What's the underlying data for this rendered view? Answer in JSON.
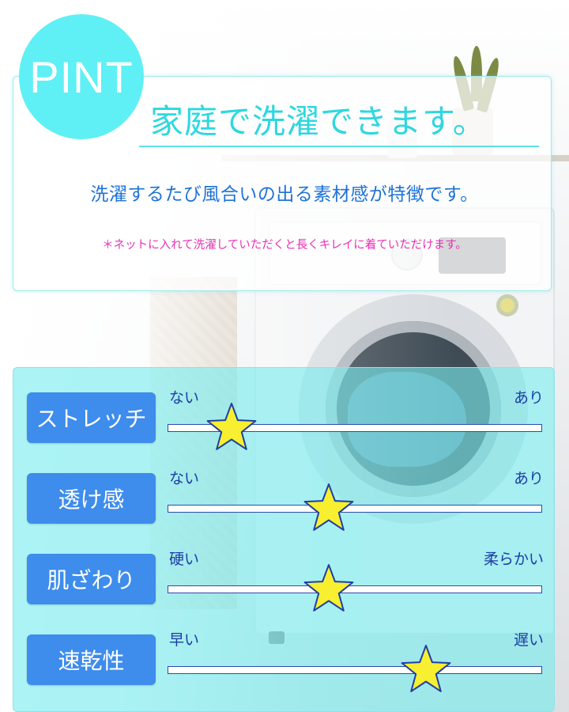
{
  "badge": {
    "text": "PINT"
  },
  "heading": "家庭で洗濯できます。",
  "subheading": "洗濯するたび風合いの出る素材感が特徴です。",
  "note": "＊ネットに入れて洗濯していただくと長くキレイに着ていただけます。",
  "colors": {
    "badge": "#5ef0f4",
    "heading": "#2fd7df",
    "subheading": "#1e73d6",
    "note": "#ea2fb6",
    "label_bg": "#3e8cec",
    "scale_text": "#1b3da6",
    "star_fill": "#f7ef2f",
    "panel": "#78ecee"
  },
  "ratings": [
    {
      "label": "ストレッチ",
      "left": "ない",
      "right": "あり",
      "level": 0.17,
      "icon": "star-icon"
    },
    {
      "label": "透け感",
      "left": "ない",
      "right": "あり",
      "level": 0.43,
      "icon": "star-icon"
    },
    {
      "label": "肌ざわり",
      "left": "硬い",
      "right": "柔らかい",
      "level": 0.43,
      "icon": "star-icon"
    },
    {
      "label": "速乾性",
      "left": "早い",
      "right": "遅い",
      "level": 0.69,
      "icon": "star-icon"
    }
  ]
}
